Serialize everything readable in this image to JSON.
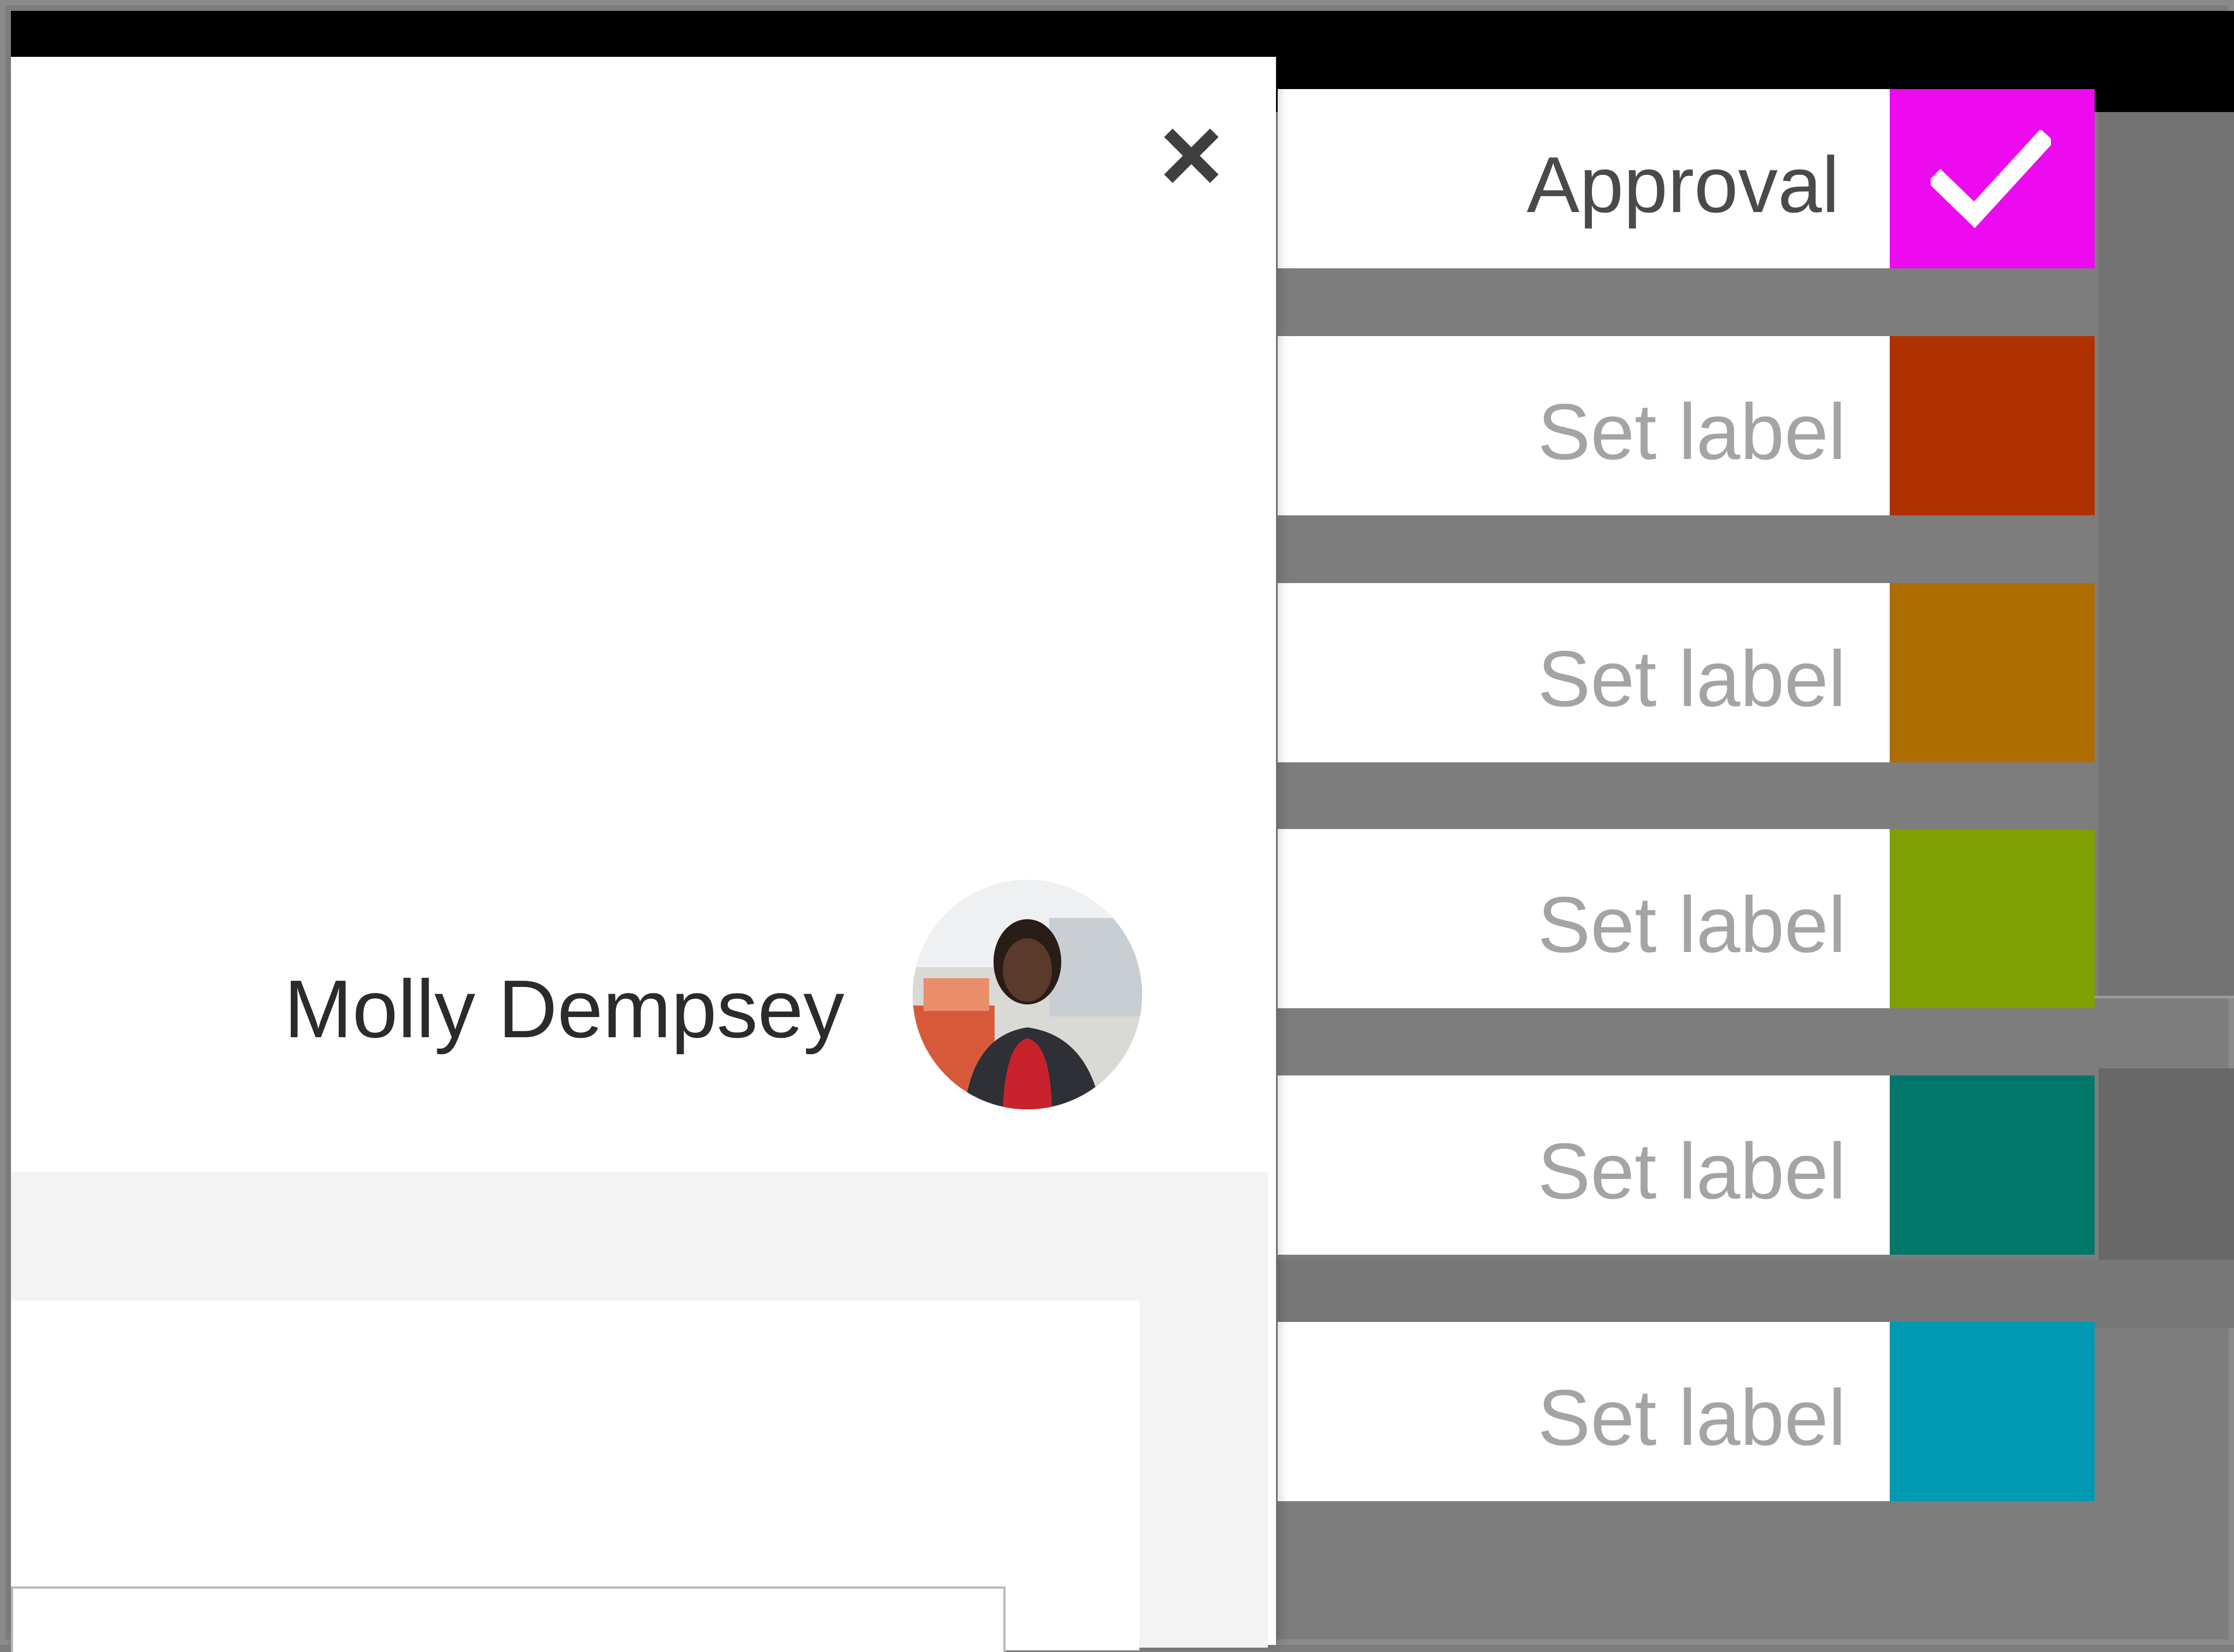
{
  "dialog": {
    "person_name": "Molly Dempsey"
  },
  "labels": [
    {
      "text": "Approval",
      "color": "#ee0aee",
      "selected": true
    },
    {
      "text": "Set label",
      "color": "#b03100",
      "selected": false
    },
    {
      "text": "Set label",
      "color": "#ae6d00",
      "selected": false
    },
    {
      "text": "Set label",
      "color": "#7ea000",
      "selected": false
    },
    {
      "text": "Set label",
      "color": "#01766b",
      "selected": false
    },
    {
      "text": "Set label",
      "color": "#0099b4",
      "selected": false
    }
  ],
  "icons": {
    "close": "close-icon",
    "check": "checkmark-icon",
    "avatar": "user-avatar"
  }
}
